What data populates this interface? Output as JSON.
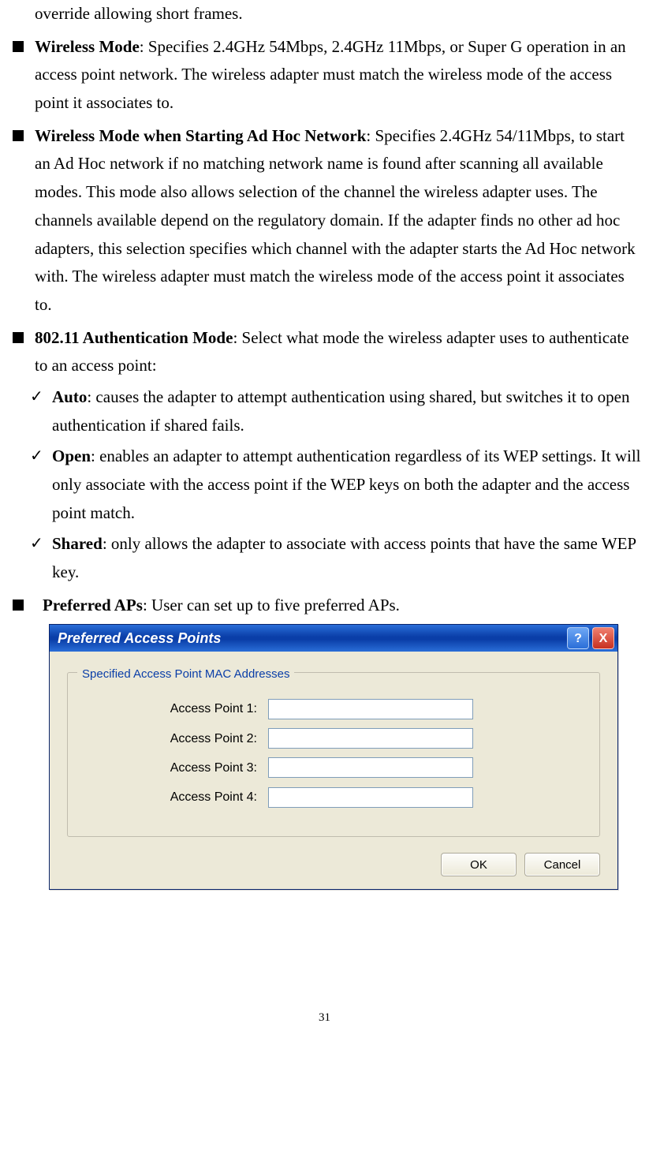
{
  "paragraphs": {
    "p0": "override allowing short frames.",
    "p1_bold": "Wireless Mode",
    "p1_rest": ": Specifies 2.4GHz 54Mbps, 2.4GHz 11Mbps, or Super G operation in an access point network. The wireless adapter must match the wireless mode of the access point it associates to.",
    "p2_bold": "Wireless Mode when Starting Ad Hoc Network",
    "p2_rest": ": Specifies 2.4GHz 54/11Mbps, to start an Ad Hoc network if no matching network name is found after scanning all available modes. This mode also allows selection of the channel the wireless adapter uses. The channels available depend on the regulatory domain. If the adapter finds no other ad hoc adapters, this selection specifies which channel with the adapter starts the Ad Hoc network with. The wireless adapter must match the wireless mode of the access point it associates to.",
    "p3_bold": "802.11 Authentication Mode",
    "p3_rest": ": Select what mode the wireless adapter uses to authenticate to an access point:",
    "c1_bold": "Auto",
    "c1_rest": ": causes the adapter to attempt authentication using shared, but switches it to open authentication if shared fails.",
    "c2_bold": "Open",
    "c2_rest": ": enables an adapter to attempt authentication regardless of its WEP settings. It will only associate with the access point if the WEP keys on both the adapter and the access point match.",
    "c3_bold": "Shared",
    "c3_rest": ": only allows the adapter to associate with access points that have the same WEP key.",
    "p4_bold": "Preferred APs",
    "p4_rest": ": User can set up to five preferred APs."
  },
  "dialog": {
    "title": "Preferred Access Points",
    "help_glyph": "?",
    "close_glyph": "X",
    "group_legend": "Specified Access Point MAC Addresses",
    "fields": [
      {
        "label": "Access Point 1:",
        "value": ""
      },
      {
        "label": "Access Point 2:",
        "value": ""
      },
      {
        "label": "Access Point 3:",
        "value": ""
      },
      {
        "label": "Access Point 4:",
        "value": ""
      }
    ],
    "ok": "OK",
    "cancel": "Cancel"
  },
  "page_number": "31"
}
